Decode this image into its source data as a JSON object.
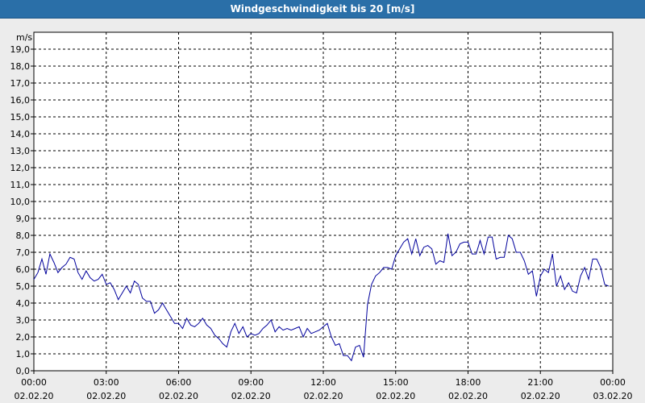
{
  "title": "Windgeschwindigkeit bis 20 [m/s]",
  "chart_data": {
    "type": "line",
    "title": "Windgeschwindigkeit bis 20 [m/s]",
    "ylabel": "m/s",
    "ylim": [
      0,
      20
    ],
    "y_ticks": [
      "0,0",
      "1,0",
      "2,0",
      "3,0",
      "4,0",
      "5,0",
      "6,0",
      "7,0",
      "8,0",
      "9,0",
      "10,0",
      "11,0",
      "12,0",
      "13,0",
      "14,0",
      "15,0",
      "16,0",
      "17,0",
      "18,0",
      "19,0"
    ],
    "x_ticks": [
      {
        "time": "00:00",
        "date": "02.02.20"
      },
      {
        "time": "03:00",
        "date": "02.02.20"
      },
      {
        "time": "06:00",
        "date": "02.02.20"
      },
      {
        "time": "09:00",
        "date": "02.02.20"
      },
      {
        "time": "12:00",
        "date": "02.02.20"
      },
      {
        "time": "15:00",
        "date": "02.02.20"
      },
      {
        "time": "18:00",
        "date": "02.02.20"
      },
      {
        "time": "21:00",
        "date": "02.02.20"
      },
      {
        "time": "00:00",
        "date": "03.02.20"
      }
    ],
    "xlim": [
      "02.02.20 00:00",
      "03.02.20 00:00"
    ],
    "grid": true,
    "line_color": "#00009c",
    "series": [
      {
        "x": [
          "00:00",
          "00:10",
          "00:20",
          "00:30",
          "00:40",
          "00:50",
          "01:00",
          "01:10",
          "01:20",
          "01:30",
          "01:40",
          "01:50",
          "02:00",
          "02:10",
          "02:20",
          "02:30",
          "02:40",
          "02:50",
          "03:00",
          "03:10",
          "03:20",
          "03:30",
          "03:40",
          "03:50",
          "04:00",
          "04:10",
          "04:20",
          "04:30",
          "04:40",
          "04:50",
          "05:00",
          "05:10",
          "05:20",
          "05:30",
          "05:40",
          "05:50",
          "06:00",
          "06:10",
          "06:20",
          "06:30",
          "06:40",
          "06:50",
          "07:00",
          "07:10",
          "07:20",
          "07:30",
          "07:40",
          "07:50",
          "08:00",
          "08:10",
          "08:20",
          "08:30",
          "08:40",
          "08:50",
          "09:00",
          "09:10",
          "09:20",
          "09:30",
          "09:40",
          "09:50",
          "10:00",
          "10:10",
          "10:20",
          "10:30",
          "10:40",
          "10:50",
          "11:00",
          "11:10",
          "11:20",
          "11:30",
          "11:40",
          "11:50",
          "12:00",
          "12:10",
          "12:20",
          "12:30",
          "12:40",
          "12:50",
          "13:00",
          "13:10",
          "13:20",
          "13:30",
          "13:40",
          "13:50",
          "14:00",
          "14:10",
          "14:20",
          "14:30",
          "14:40",
          "14:50",
          "15:00",
          "15:10",
          "15:20",
          "15:30",
          "15:40",
          "15:50",
          "16:00",
          "16:10",
          "16:20",
          "16:30",
          "16:40",
          "16:50",
          "17:00",
          "17:10",
          "17:20",
          "17:30",
          "17:40",
          "17:50",
          "18:00",
          "18:10",
          "18:20",
          "18:30",
          "18:40",
          "18:50",
          "19:00",
          "19:10",
          "19:20",
          "19:30",
          "19:40",
          "19:50",
          "20:00",
          "20:10",
          "20:20",
          "20:30",
          "20:40",
          "20:50",
          "21:00",
          "21:10",
          "21:20",
          "21:30",
          "21:40",
          "21:50",
          "22:00",
          "22:10",
          "22:20",
          "22:30",
          "22:40",
          "22:50",
          "23:00",
          "23:10",
          "23:20",
          "23:30",
          "23:40",
          "23:50"
        ],
        "y": [
          5.4,
          5.8,
          6.6,
          5.7,
          6.9,
          6.4,
          5.8,
          6.1,
          6.3,
          6.7,
          6.6,
          5.8,
          5.4,
          5.9,
          5.5,
          5.3,
          5.4,
          5.7,
          5.1,
          5.2,
          4.8,
          4.2,
          4.6,
          5.0,
          4.6,
          5.3,
          5.1,
          4.3,
          4.1,
          4.1,
          3.4,
          3.6,
          4.0,
          3.6,
          3.2,
          2.8,
          2.8,
          2.5,
          3.1,
          2.7,
          2.6,
          2.8,
          3.1,
          2.7,
          2.5,
          2.1,
          1.9,
          1.6,
          1.4,
          2.3,
          2.8,
          2.2,
          2.6,
          2.0,
          2.2,
          2.1,
          2.2,
          2.5,
          2.7,
          3.0,
          2.3,
          2.6,
          2.4,
          2.5,
          2.4,
          2.5,
          2.6,
          2.0,
          2.5,
          2.2,
          2.3,
          2.4,
          2.6,
          2.8,
          2.0,
          1.5,
          1.6,
          0.9,
          0.9,
          0.6,
          1.4,
          1.5,
          0.8,
          3.9,
          5.1,
          5.6,
          5.8,
          6.1,
          6.1,
          6.0,
          6.8,
          7.2,
          7.6,
          7.8,
          6.9,
          7.8,
          6.8,
          7.3,
          7.4,
          7.2,
          6.3,
          6.5,
          6.4,
          8.1,
          6.8,
          7.0,
          7.5,
          7.6,
          7.6,
          6.9,
          6.9,
          7.7,
          6.9,
          7.9,
          7.9,
          6.6,
          6.7,
          6.7,
          8.0,
          7.8,
          7.0,
          7.0,
          6.5,
          5.7,
          5.9,
          4.4,
          5.6,
          6.0,
          5.8,
          6.9,
          5.0,
          5.6,
          4.8,
          5.2,
          4.7,
          4.6,
          5.6,
          6.1,
          5.4,
          6.6,
          6.6,
          6.1,
          5.1,
          5.0
        ]
      }
    ]
  }
}
